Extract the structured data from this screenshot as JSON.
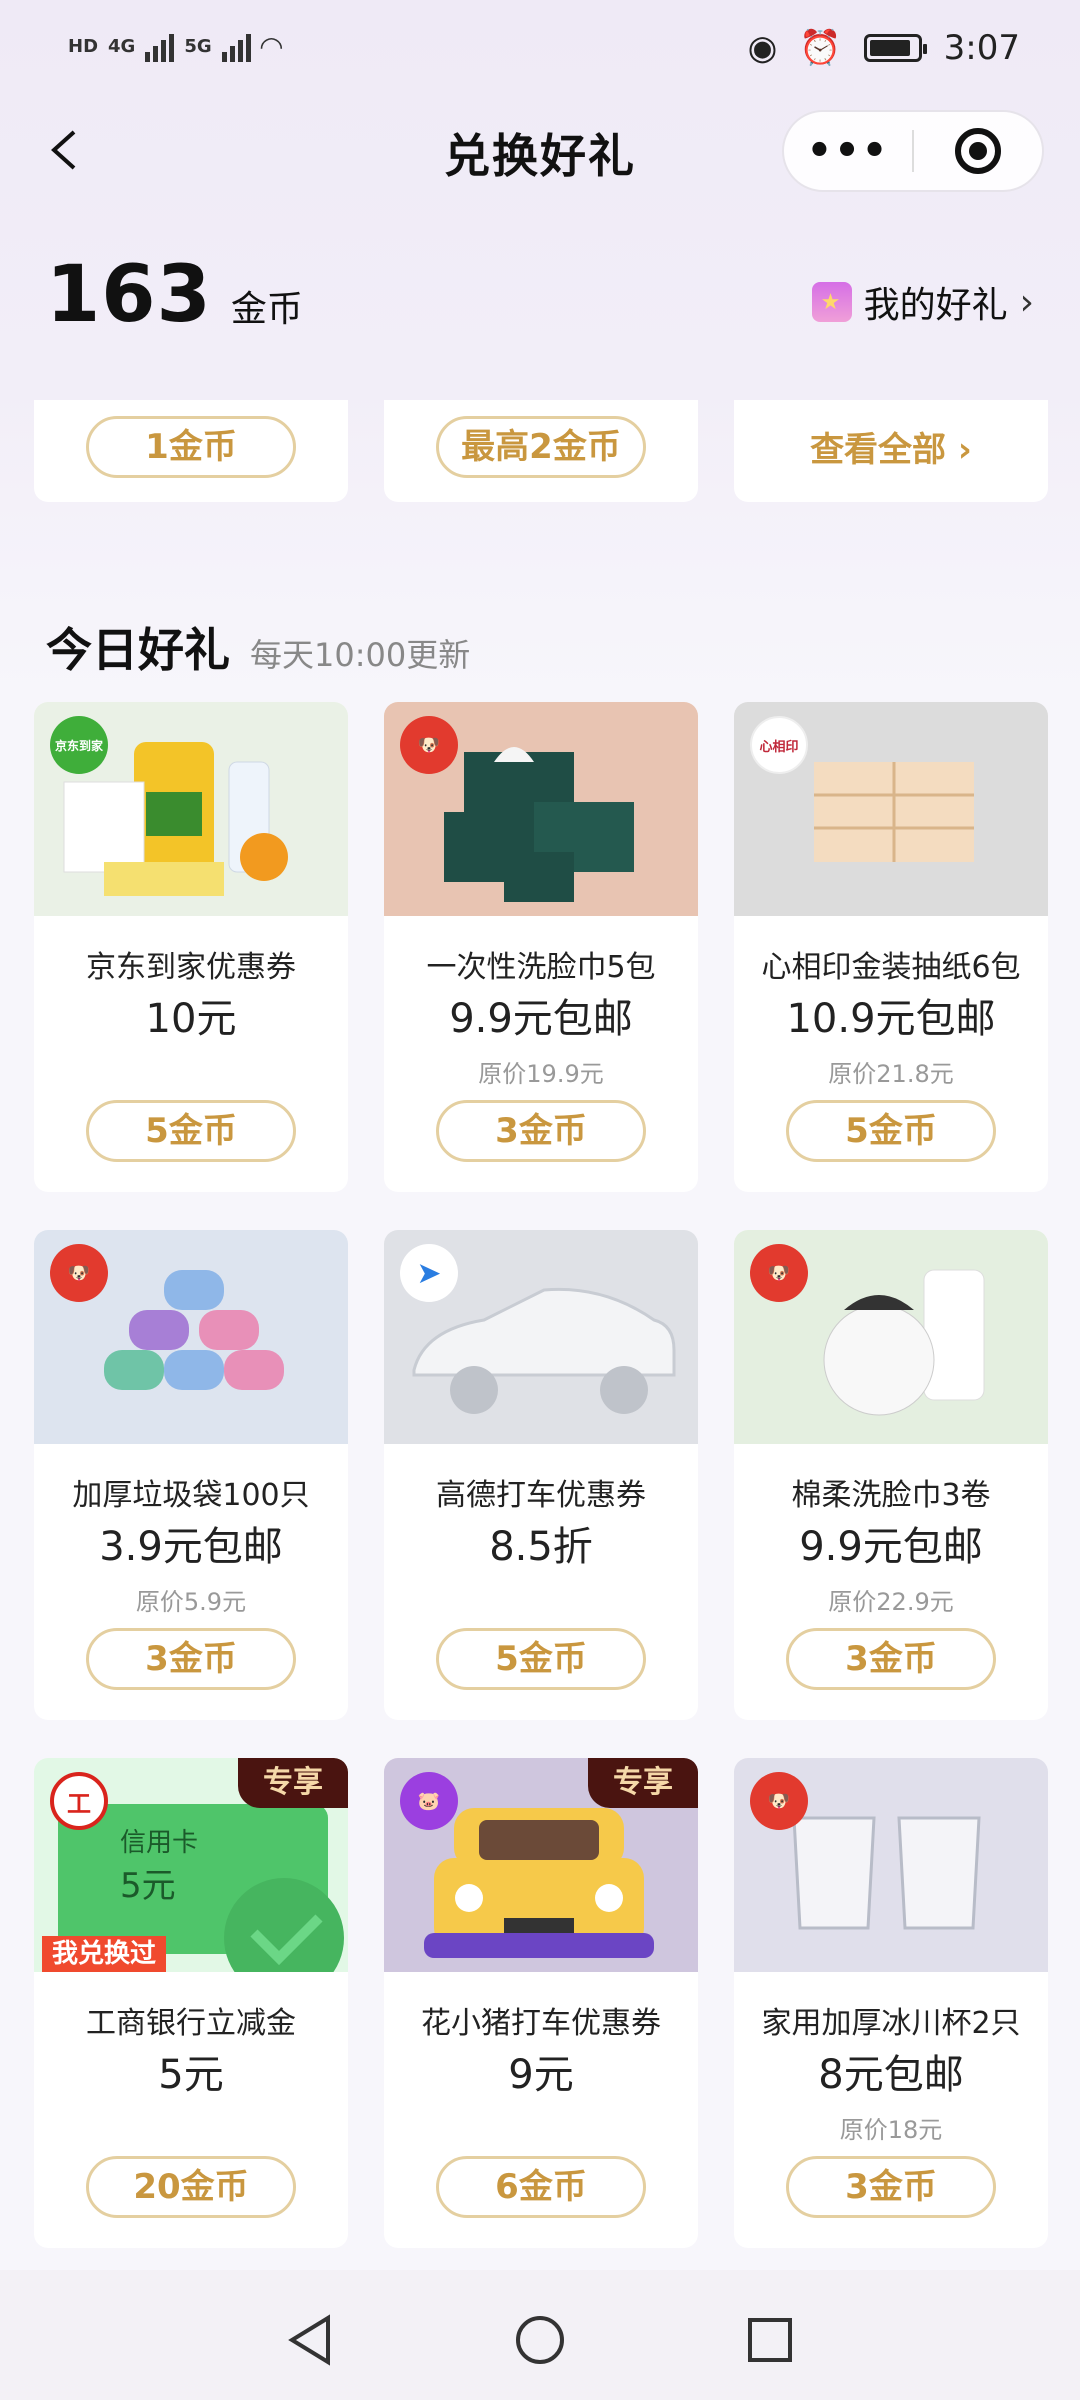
{
  "status_bar": {
    "time": "3:07",
    "net1": "4G",
    "net2": "5G"
  },
  "nav": {
    "title": "兑换好礼",
    "menu_dots": "•••"
  },
  "coins": {
    "value": "163",
    "unit": "金币",
    "my_gifts": "我的好礼"
  },
  "top_row": [
    {
      "price": "1金币"
    },
    {
      "price": "最高2金币"
    },
    {
      "see_all": "查看全部"
    }
  ],
  "section": {
    "title": "今日好礼",
    "subtitle": "每天10:00更新"
  },
  "items": [
    {
      "name": "京东到家优惠券",
      "price": "10元",
      "orig": "",
      "coins": "5金币",
      "logo_text": "京东到家",
      "logo_color": "#3fae3a",
      "bg": "#eaf1e6"
    },
    {
      "name": "一次性洗脸巾5包",
      "price": "9.9元包邮",
      "orig": "原价19.9元",
      "coins": "3金币",
      "logo_text": "",
      "logo_color": "#e23a2e",
      "bg": "#e8c4b2"
    },
    {
      "name": "心相印金装抽纸6包",
      "price": "10.9元包邮",
      "orig": "原价21.8元",
      "coins": "5金币",
      "logo_text": "心相印",
      "logo_color": "#ffffff",
      "bg": "#dcdcdc"
    },
    {
      "name": "加厚垃圾袋100只",
      "price": "3.9元包邮",
      "orig": "原价5.9元",
      "coins": "3金币",
      "logo_text": "",
      "logo_color": "#e23a2e",
      "bg": "#dde4ef"
    },
    {
      "name": "高德打车优惠券",
      "price": "8.5折",
      "orig": "",
      "coins": "5金币",
      "logo_text": "",
      "logo_color": "#ffffff",
      "bg": "#dfe1e6"
    },
    {
      "name": "棉柔洗脸巾3卷",
      "price": "9.9元包邮",
      "orig": "原价22.9元",
      "coins": "3金币",
      "logo_text": "",
      "logo_color": "#e23a2e",
      "bg": "#e4efe0"
    },
    {
      "name": "工商银行立减金",
      "price": "5元",
      "orig": "",
      "coins": "20金币",
      "logo_text": "工",
      "logo_color": "#d9241c",
      "bg": "#e2f8e6",
      "exclusive": "专享",
      "exchanged": "我兑换过",
      "card_label": "信用卡",
      "card_value": "5元"
    },
    {
      "name": "花小猪打车优惠券",
      "price": "9元",
      "orig": "",
      "coins": "6金币",
      "logo_text": "",
      "logo_color": "#9b3fe0",
      "bg": "#cfc6de",
      "exclusive": "专享"
    },
    {
      "name": "家用加厚冰川杯2只",
      "price": "8元包邮",
      "orig": "原价18元",
      "coins": "3金币",
      "logo_text": "",
      "logo_color": "#e23a2e",
      "bg": "#e0dfeb"
    }
  ]
}
